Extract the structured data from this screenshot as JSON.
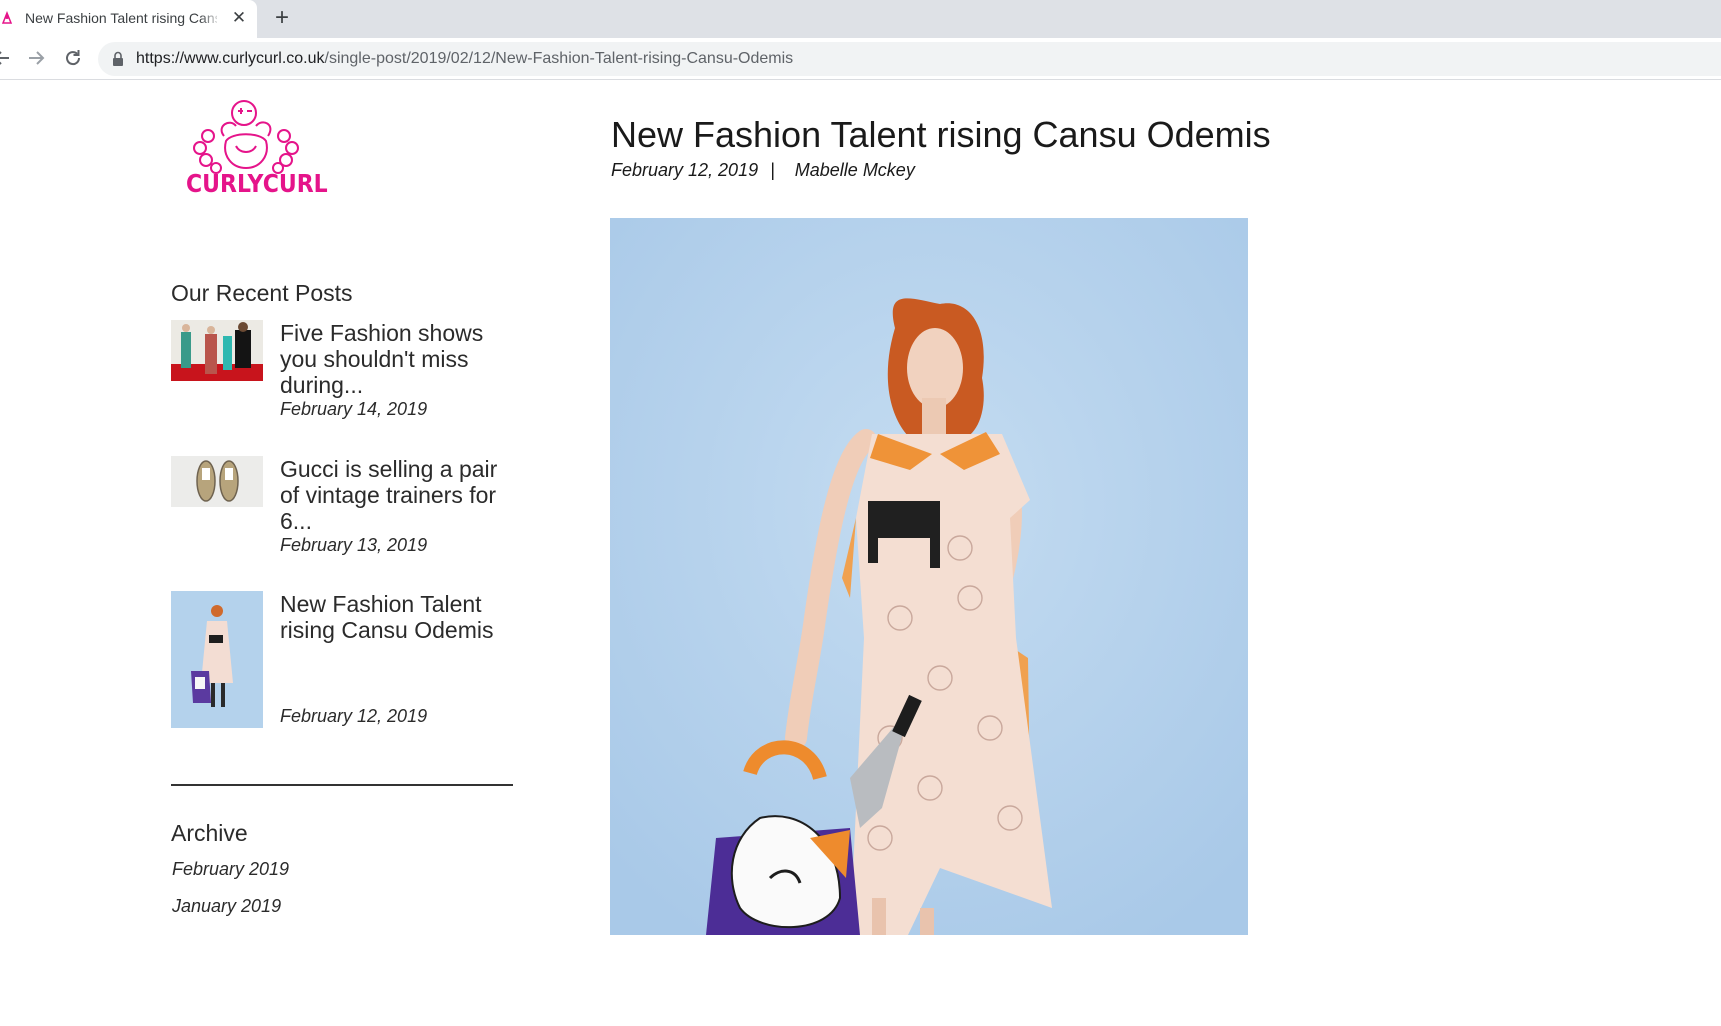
{
  "browser": {
    "tab_title": "New Fashion Talent rising Cansu Odemis",
    "tab_close": "✕",
    "new_tab": "+",
    "url_host": "https://www.curlycurl.co.uk",
    "url_path": "/single-post/2019/02/12/New-Fashion-Talent-rising-Cansu-Odemis",
    "icons": [
      "back-arrow-icon",
      "forward-arrow-icon",
      "reload-icon",
      "lock-icon",
      "favicon-icon"
    ]
  },
  "site": {
    "logo_text": "CURLYCURL",
    "brand_color": "#e5148a"
  },
  "sidebar": {
    "recent_posts_heading": "Our Recent Posts",
    "recent_posts": [
      {
        "title": "Five Fashion shows you shouldn't miss during...",
        "date": "February 14, 2019"
      },
      {
        "title": "Gucci is selling a pair of vintage trainers for 6...",
        "date": "February 13, 2019"
      },
      {
        "title": "New Fashion Talent rising Cansu Odemis",
        "date": "February 12, 2019"
      }
    ],
    "archive_heading": "Archive",
    "archive_links": [
      "February 2019",
      "January 2019"
    ]
  },
  "article": {
    "title": "New Fashion Talent rising Cansu Odemis",
    "date": "February 12, 2019",
    "separator": "|",
    "author": "Mabelle Mckey",
    "hero_background": "#b7d3ec"
  }
}
